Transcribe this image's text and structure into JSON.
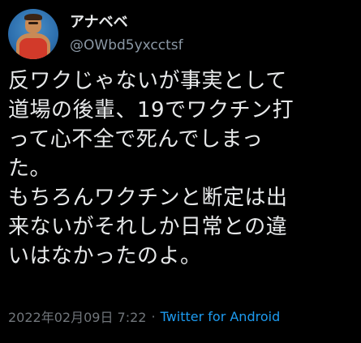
{
  "tweet": {
    "author": {
      "display_name": "アナベベ",
      "handle": "@OWbd5yxcctsf",
      "avatar_icon": "avatar-icon"
    },
    "text_lines": [
      "反ワクじゃないが事実として",
      "道場の後輩、19でワクチン打",
      "って心不全で死んでしまっ",
      "た。",
      "もちろんワクチンと断定は出",
      "来ないがそれしか日常との違",
      "いはなかったのよ。"
    ],
    "timestamp": "2022年02月09日 7:22",
    "separator": "·",
    "source": "Twitter for Android"
  },
  "colors": {
    "background": "#000000",
    "primary_text": "#e7e9ea",
    "secondary_text": "#8b98a5",
    "link": "#1d9bf0"
  }
}
